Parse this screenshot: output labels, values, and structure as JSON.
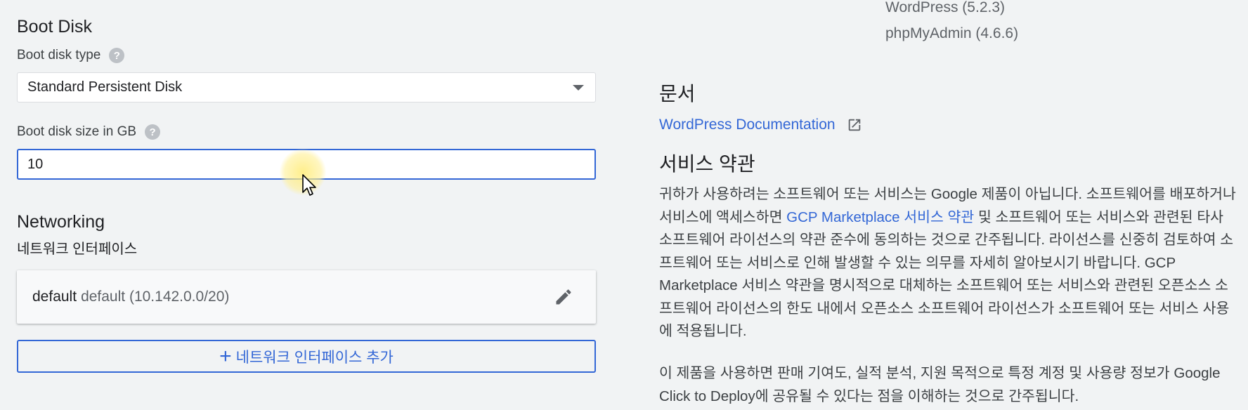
{
  "boot_disk": {
    "title": "Boot Disk",
    "type_label": "Boot disk type",
    "type_value": "Standard Persistent Disk",
    "size_label": "Boot disk size in GB",
    "size_value": "10"
  },
  "networking": {
    "title": "Networking",
    "subtitle": "네트워크 인터페이스",
    "interface": {
      "name": "default",
      "detail": "default (10.142.0.0/20)"
    },
    "add_button_label": "네트워크 인터페이스 추가"
  },
  "packages": [
    "WordPress (5.2.3)",
    "phpMyAdmin (4.6.6)"
  ],
  "docs": {
    "title": "문서",
    "link_label": "WordPress Documentation"
  },
  "terms": {
    "title": "서비스 약관",
    "p1_before": "귀하가 사용하려는 소프트웨어 또는 서비스는 Google 제품이 아닙니다. 소프트웨어를 배포하거나 서비스에 액세스하면 ",
    "p1_link": "GCP Marketplace 서비스 약관",
    "p1_after": " 및 소프트웨어 또는 서비스와 관련된 타사 소프트웨어 라이선스의 약관 준수에 동의하는 것으로 간주됩니다. 라이선스를 신중히 검토하여 소프트웨어 또는 서비스로 인해 발생할 수 있는 의무를 자세히 알아보시기 바랍니다. GCP Marketplace 서비스 약관을 명시적으로 대체하는 소프트웨어 또는 서비스와 관련된 오픈소스 소프트웨어 라이선스의 한도 내에서 오픈소스 소프트웨어 라이선스가 소프트웨어 또는 서비스 사용에 적용됩니다.",
    "p2": "이 제품을 사용하면 판매 기여도, 실적 분석, 지원 목적으로 특정 계정 및 사용량 정보가 Google Click to Deploy에 공유될 수 있다는 점을 이해하는 것으로 간주됩니다."
  },
  "colors": {
    "accent": "#3367d6",
    "background": "#f1f3f4"
  },
  "icons": {
    "help": "help-icon",
    "dropdown": "chevron-down-icon",
    "edit": "pencil-icon",
    "add": "plus-icon",
    "external": "external-link-icon"
  }
}
